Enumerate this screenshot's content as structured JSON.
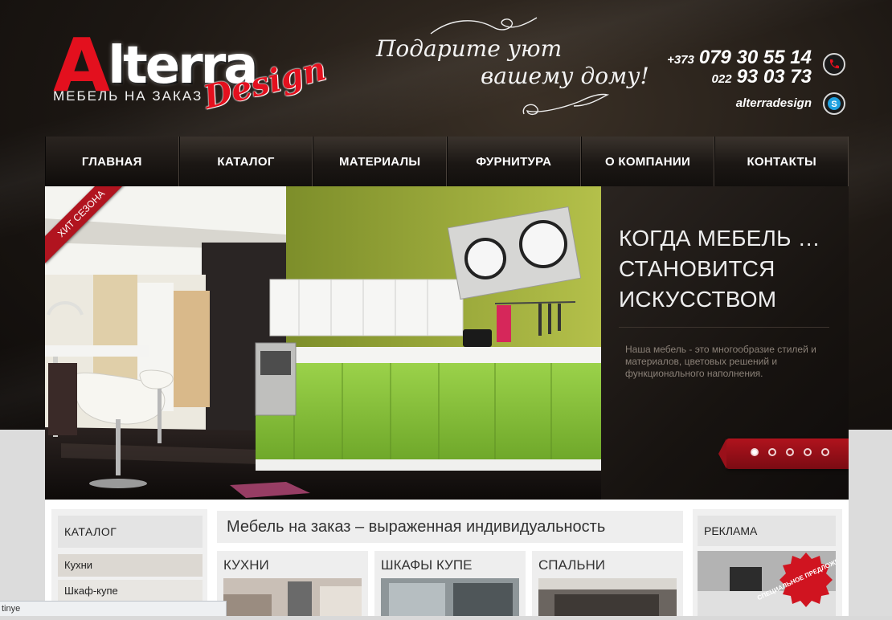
{
  "logo": {
    "A": "A",
    "rest": "lterra",
    "design": "Design",
    "tagline": "МЕБЕЛЬ НА ЗАКАЗ"
  },
  "slogan": {
    "line1": "Подарите уют",
    "line2": "вашему дому!"
  },
  "contacts": {
    "phone1_prefix": "+373",
    "phone1": "079 30 55 14",
    "phone2_prefix": "022",
    "phone2": "93 03 73",
    "skype": "alterradesign",
    "phone_icon": "phone-icon",
    "skype_icon": "skype-icon"
  },
  "nav": {
    "items": [
      {
        "label": "ГЛАВНАЯ"
      },
      {
        "label": "КАТАЛОГ"
      },
      {
        "label": "МАТЕРИАЛЫ"
      },
      {
        "label": "ФУРНИТУРА"
      },
      {
        "label": "О КОМПАНИИ"
      },
      {
        "label": "КОНТАКТЫ"
      }
    ],
    "active_index": 0
  },
  "slider": {
    "badge": "ХИТ СЕЗОНА",
    "title_line1": "КОГДА МЕБЕЛЬ …",
    "title_line2": "СТАНОВИТСЯ",
    "title_line3": "ИСКУССТВОМ",
    "text": "Наша мебель - это многообразие стилей и материалов, цветовых решений и функционального наполнения.",
    "dot_count": 5,
    "active_dot": 0
  },
  "catalog": {
    "heading": "КАТАЛОГ",
    "items": [
      {
        "label": "Кухни"
      },
      {
        "label": "Шкаф-купе"
      }
    ]
  },
  "main": {
    "heading": "Мебель на заказ – выраженная индивидуальность",
    "tiles": [
      {
        "label": "КУХНИ"
      },
      {
        "label": "ШКАФЫ КУПЕ"
      },
      {
        "label": "СПАЛЬНИ"
      }
    ]
  },
  "ads": {
    "heading": "РЕКЛАМА",
    "badge": "СПЕЦИАЛЬНОЕ ПРЕДЛОЖЕНИЕ"
  },
  "statusbar": {
    "text": "tinye"
  },
  "colors": {
    "accent_red": "#e3101e",
    "kitchen_green": "#8cc63f",
    "wall_green": "#a8b83a",
    "header_dark": "#1c1713"
  }
}
